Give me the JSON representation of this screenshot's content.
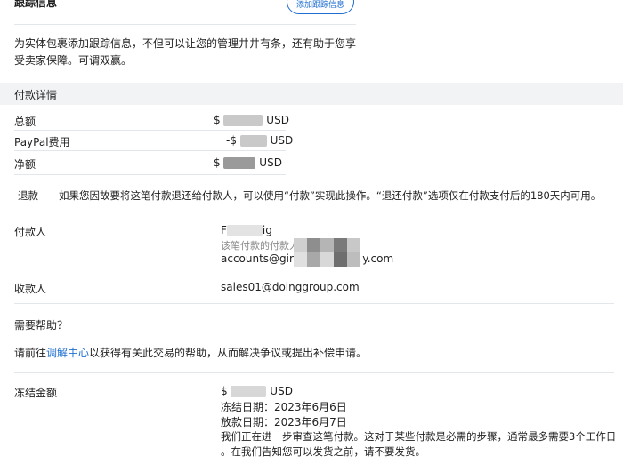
{
  "header": {
    "title": "跟踪信息",
    "add_tracking_button": "添加跟踪信息"
  },
  "intro_text": {
    "line1": "为实体包裹添加跟踪信息，不但可以让您的管理井井有条，还有助于您享",
    "line2": "受卖家保障。可谓双赢。"
  },
  "payment_details": {
    "section_title": "付款详情",
    "gross_label": "总额",
    "gross_prefix": "$",
    "gross_currency": "USD",
    "fee_label": "PayPal费用",
    "fee_prefix": "-$",
    "fee_currency": "USD",
    "net_label": "净额",
    "net_prefix": "$",
    "net_currency": "USD"
  },
  "refund_note": "退款——如果您因故要将这笔付款退还给付款人，可以使用“付款”实现此操作。“退还付款”选项仅在付款支付后的180天内可用。",
  "payer": {
    "label": "付款人",
    "name_start": "F",
    "name_end": "ig",
    "note": "该笔付款的付款人",
    "email_start": "accounts@gira",
    "email_end": "y.com"
  },
  "payee": {
    "label": "收款人",
    "email": "sales01@doinggroup.com"
  },
  "help": {
    "title": "需要帮助？",
    "text_before": "请前往",
    "link": "调解中心",
    "text_after": "以获得有关此交易的帮助，从而解决争议或提出补偿申请。"
  },
  "frozen": {
    "label": "冻结金额",
    "amount_prefix": "$",
    "amount_currency": "USD",
    "freeze_date": "冻结日期：2023年6月6日",
    "release_date": "放款日期：2023年6月7日",
    "review_line1": "我们正在进一步审查这笔付款。这对于某些付款是必需的步骤，通常最多需要3个工作日",
    "review_line2": "。在我们告知您可以发货之前，请不要发货。"
  }
}
